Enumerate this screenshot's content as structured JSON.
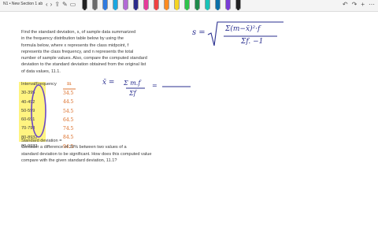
{
  "toolbar": {
    "title": "N1 • New Section 1 ab",
    "left_icons": [
      "back-icon",
      "forward-icon",
      "share-icon",
      "pen-tool-icon",
      "eraser-icon"
    ],
    "right_icons": [
      "undo-icon",
      "redo-icon",
      "add-icon",
      "more-icon"
    ],
    "pen_colors": [
      "#222222",
      "#6c6c6c",
      "#2f7be0",
      "#1aa6e0",
      "#b36ad6",
      "#2b2b8a",
      "#e63a9a",
      "#f04040",
      "#ff8a1e",
      "#f5d422",
      "#2ec44a",
      "#1e8a4a",
      "#19c3b8",
      "#0c6fa8",
      "#7a3cd6",
      "#222222"
    ]
  },
  "problem": {
    "lines": [
      "Find the standard deviation, s, of sample data summarized",
      "in the frequency distribution table below by using the",
      "formula below, where x represents the class midpoint, f",
      "represents the class frequency, and n represents the total",
      "number of sample values. Also, compare the computed standard",
      "deviation to the standard deviation obtained from the original list",
      "of data values, 11.1."
    ]
  },
  "table": {
    "header": "IntervalFrequency",
    "rows": [
      "30-395",
      "40-492",
      "50-599",
      "60-691",
      "70-798",
      "80-8932",
      "90-9933"
    ]
  },
  "midpoints": {
    "header": "m",
    "values": [
      "34.5",
      "44.5",
      "54.5",
      "64.5",
      "74.5",
      "84.5",
      "94.5"
    ]
  },
  "standard_deviation": {
    "label": "Standard deviation =",
    "lines": [
      "Consider a difference of 20% between two values of a",
      "standard deviation to be significant. How does this computed value",
      "compare with the given standard deviation, 11.1?"
    ]
  },
  "handwriting": {
    "mean_lhs": "x̄ =",
    "mean_num": "Σ m.f",
    "mean_den": "Σf",
    "mean_eq": "=",
    "s_lhs": "s =",
    "s_num": "Σ(m−x̄)²·f",
    "s_den": "Σf. −1"
  },
  "colors": {
    "handwriting_blue": "#2a2f8f",
    "handwriting_orange": "#d9661c",
    "highlight_yellow": "#fff26b",
    "circle_purple": "#6b48c8"
  }
}
